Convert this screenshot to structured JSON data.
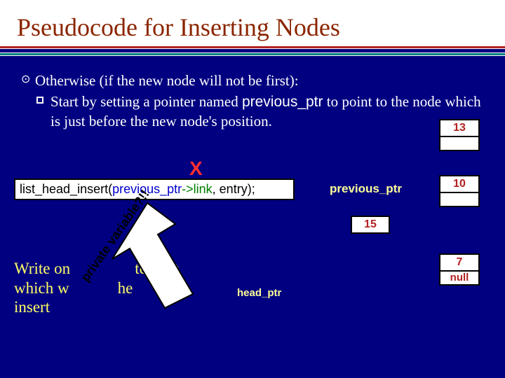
{
  "title": "Pseudocode for Inserting Nodes",
  "bullet": {
    "main": "Otherwise (if the new node will not be first):",
    "sub_part1": "Start by setting a pointer named ",
    "sub_code": "previous_ptr",
    "sub_part2": " to point to the node which is just before the new node's position."
  },
  "nodes": {
    "n13": "13",
    "n10": "10",
    "n15": "15",
    "n7": "7",
    "null": "null"
  },
  "x_mark": "X",
  "call": {
    "fn": "list_head_insert(",
    "arg1a": "previous_ptr",
    "arg1b": "->link",
    "sep": ", ",
    "arg2": "entry",
    "close": ");"
  },
  "labels": {
    "previous_ptr": "previous_ptr",
    "head_ptr": "head_ptr"
  },
  "write_stmt": {
    "line1a": "Write on",
    "line1b": "tement",
    "line2a": "which w",
    "line2b": "he",
    "line3": "insert"
  },
  "diag": "private variable?!!"
}
